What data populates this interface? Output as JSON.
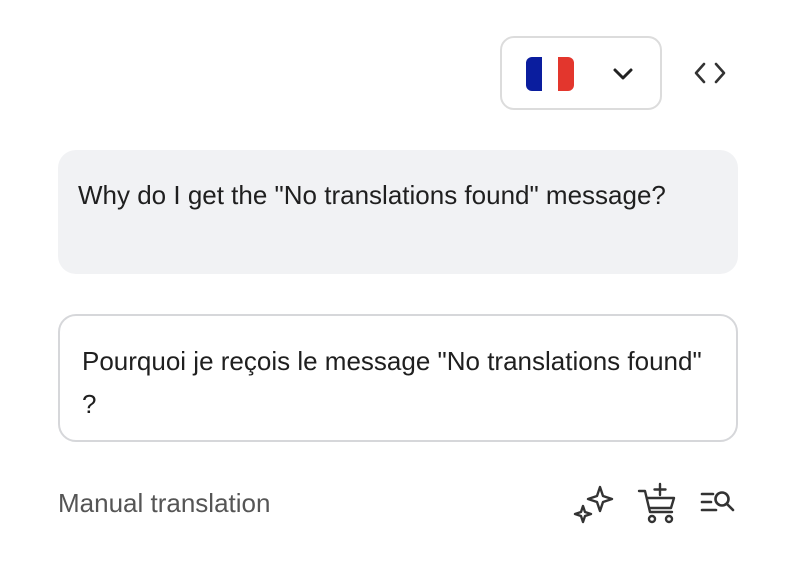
{
  "language_selector": {
    "selected_flag": "france-flag",
    "flag_colors": [
      "#0a1d9e",
      "#ffffff",
      "#e3362d"
    ],
    "chevron_icon": "chevron-down-icon"
  },
  "code_toggle_icon": "code-brackets-icon",
  "source": {
    "text": "Why do I get the \"No translations found\" message?"
  },
  "translation": {
    "text": "Pourquoi je reçois le message \"No translations found\" ?"
  },
  "footer": {
    "label": "Manual translation",
    "icons": [
      "sparkles-icon",
      "cart-add-icon",
      "search-list-icon"
    ]
  },
  "colors": {
    "source_background": "#f1f2f4",
    "border": "#d6d7da",
    "icon": "#333333"
  }
}
